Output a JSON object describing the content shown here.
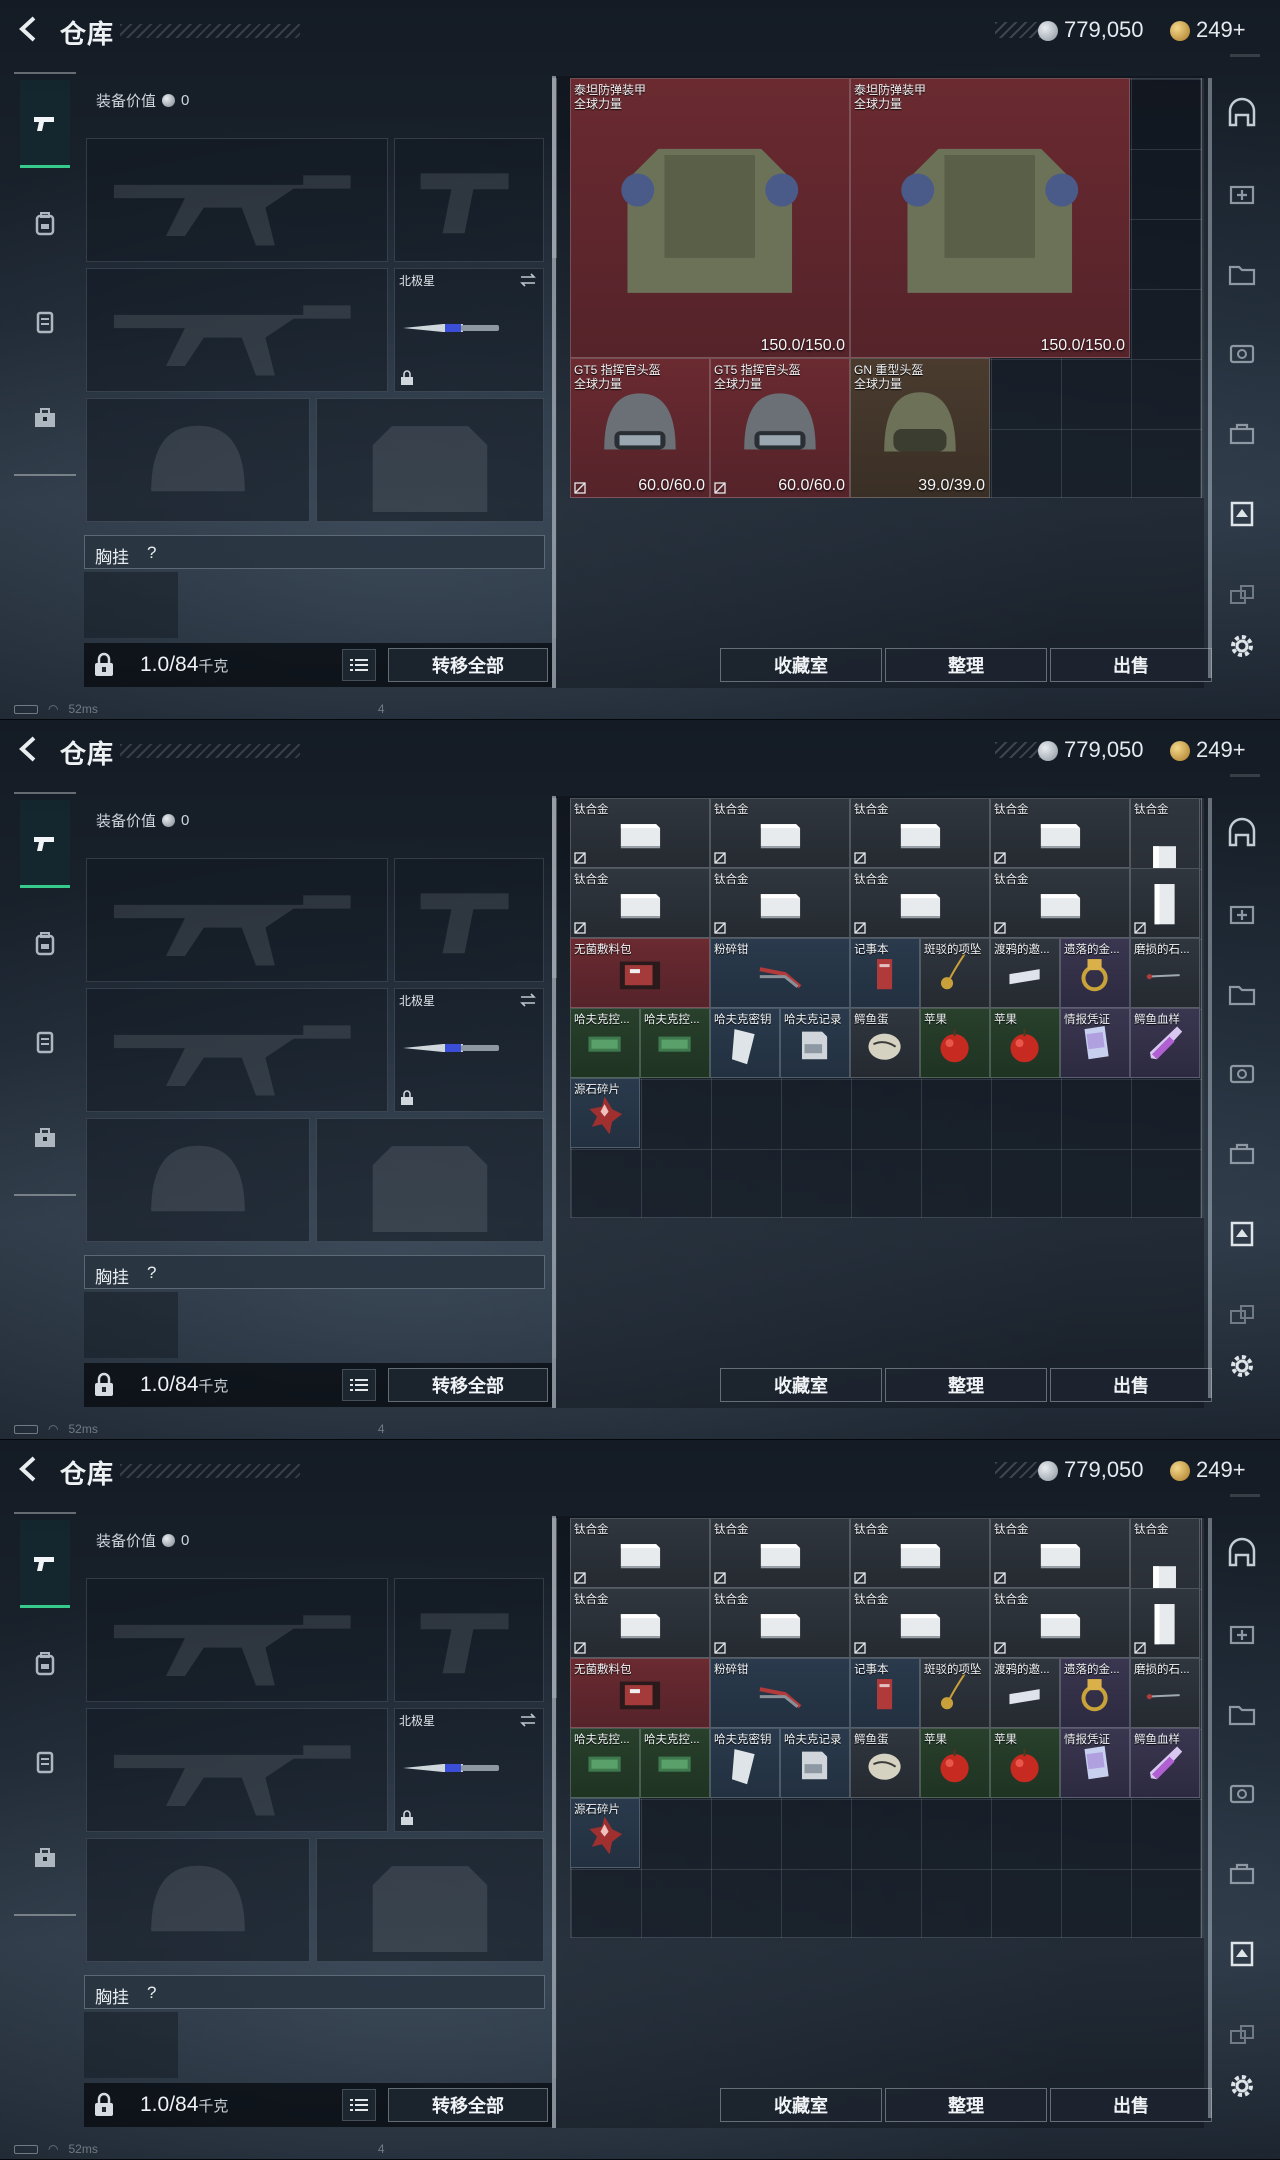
{
  "header": {
    "title": "仓库",
    "silver_value": "779,050",
    "gold_value": "249+"
  },
  "equipment": {
    "value_label": "装备价值",
    "value": "0",
    "melee_name": "北极星",
    "chest_label": "胸挂",
    "chest_help": "?"
  },
  "bottom": {
    "weight_value": "1.0/84",
    "weight_unit": "千克",
    "transfer_all": "转移全部",
    "vault": "收藏室",
    "sort": "整理",
    "sell": "出售"
  },
  "status": {
    "ping": "52ms",
    "page": "4"
  },
  "panel1_items": [
    {
      "name": "泰坦防弹装甲",
      "sub": "全球力量",
      "dur": "150.0/150.0",
      "rarity": "red"
    },
    {
      "name": "泰坦防弹装甲",
      "sub": "全球力量",
      "dur": "150.0/150.0",
      "rarity": "red"
    },
    {
      "name": "GT5 指挥官头盔",
      "sub": "全球力量",
      "dur": "60.0/60.0",
      "rarity": "red"
    },
    {
      "name": "GT5 指挥官头盔",
      "sub": "全球力量",
      "dur": "60.0/60.0",
      "rarity": "red"
    },
    {
      "name": "GN 重型头盔",
      "sub": "全球力量",
      "dur": "39.0/39.0",
      "rarity": "brown"
    }
  ],
  "grid_items": {
    "titanium": "钛合金",
    "row3": [
      "无菌敷料包",
      "粉碎钳",
      "记事本",
      "斑驳的项坠",
      "渡鸦的邀...",
      "遗落的金...",
      "磨损的石..."
    ],
    "row4": [
      "哈夫克控...",
      "哈夫克控...",
      "哈夫克密钥",
      "哈夫克记录",
      "鳄鱼蛋",
      "苹果",
      "苹果",
      "情报凭证",
      "鳄鱼血样"
    ],
    "row5": [
      "源石碎片"
    ]
  },
  "icons": {
    "back": "back-arrow-icon",
    "weapon_tab": "pistol-icon",
    "backpack_tab": "backpack-icon",
    "rig_tab": "vest-icon",
    "case_tab": "case-icon",
    "settings": "gear-icon"
  },
  "colors": {
    "accent_green": "#38c98c",
    "red_rarity": "#6a2a30",
    "purple_rarity": "#3a3650"
  }
}
